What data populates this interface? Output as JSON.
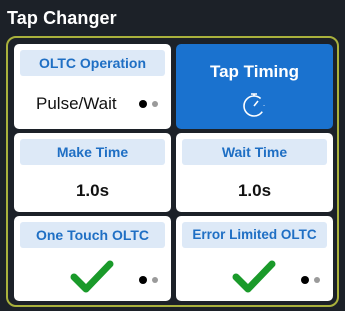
{
  "panel": {
    "title": "Tap Changer"
  },
  "tiles": {
    "oltc_operation": {
      "label": "OLTC Operation",
      "value": "Pulse/Wait",
      "page_dots": 2,
      "current_page": 1
    },
    "tap_timing": {
      "label": "Tap Timing",
      "icon": "timer-icon",
      "selected": true
    },
    "make_time": {
      "label": "Make Time",
      "value": "1.0s"
    },
    "wait_time": {
      "label": "Wait Time",
      "value": "1.0s"
    },
    "one_touch_oltc": {
      "label": "One Touch OLTC",
      "checked": true,
      "icon": "checkmark-icon",
      "page_dots": 2,
      "current_page": 1
    },
    "error_limited_oltc": {
      "label": "Error Limited OLTC",
      "checked": true,
      "icon": "checkmark-icon",
      "page_dots": 2,
      "current_page": 1
    }
  },
  "colors": {
    "panel_background": "#1c2128",
    "frame_border": "#a9b13c",
    "tile_header_background": "#dde9f7",
    "tile_header_text": "#1f6fc4",
    "selected_tile": "#1a72cf",
    "check": "#1a9a2a"
  }
}
